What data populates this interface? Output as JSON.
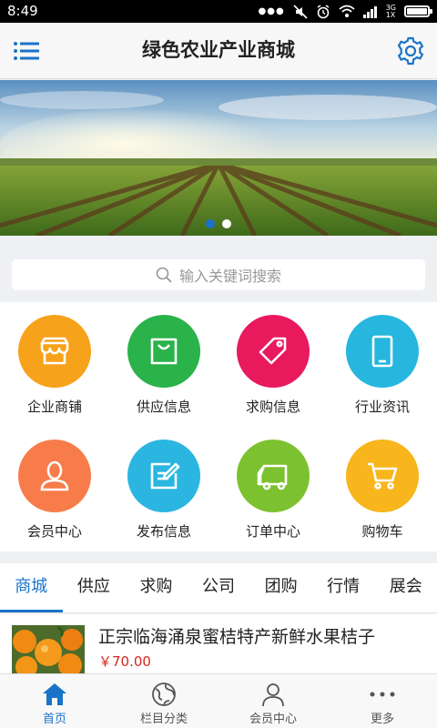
{
  "status_bar": {
    "time": "8:49",
    "network_top": "3G",
    "network_bottom": "1X",
    "battery_level": 0.9
  },
  "header": {
    "title": "绿色农业产业商城",
    "menu_icon": "menu-icon",
    "settings_icon": "gear-icon"
  },
  "banner": {
    "slide_count": 2,
    "active_slide": 1
  },
  "search": {
    "placeholder": "输入关键词搜索",
    "icon": "search-icon"
  },
  "grid": {
    "items": [
      {
        "label": "企业商铺",
        "icon": "shop-icon",
        "color": "#f7a21b"
      },
      {
        "label": "供应信息",
        "icon": "shopping-bag-icon",
        "color": "#2ab24b"
      },
      {
        "label": "求购信息",
        "icon": "price-tag-icon",
        "color": "#e8195d"
      },
      {
        "label": "行业资讯",
        "icon": "tablet-icon",
        "color": "#27b6de"
      },
      {
        "label": "会员中心",
        "icon": "user-icon",
        "color": "#f77c4a"
      },
      {
        "label": "发布信息",
        "icon": "edit-icon",
        "color": "#2ab6e0"
      },
      {
        "label": "订单中心",
        "icon": "truck-icon",
        "color": "#7cc12f"
      },
      {
        "label": "购物车",
        "icon": "cart-icon",
        "color": "#f8b51c"
      }
    ]
  },
  "tabs": {
    "items": [
      "商城",
      "供应",
      "求购",
      "公司",
      "团购",
      "行情",
      "展会"
    ],
    "active": 0
  },
  "product": {
    "name": "正宗临海涌泉蜜桔特产新鲜水果桔子",
    "price": "￥70.00"
  },
  "bottom_nav": {
    "items": [
      {
        "label": "首页",
        "icon": "home-icon"
      },
      {
        "label": "栏目分类",
        "icon": "category-icon"
      },
      {
        "label": "会员中心",
        "icon": "user-icon"
      },
      {
        "label": "更多",
        "icon": "more-icon"
      }
    ],
    "active": 0
  },
  "colors": {
    "accent": "#1a73c9",
    "price": "#d7261d"
  }
}
